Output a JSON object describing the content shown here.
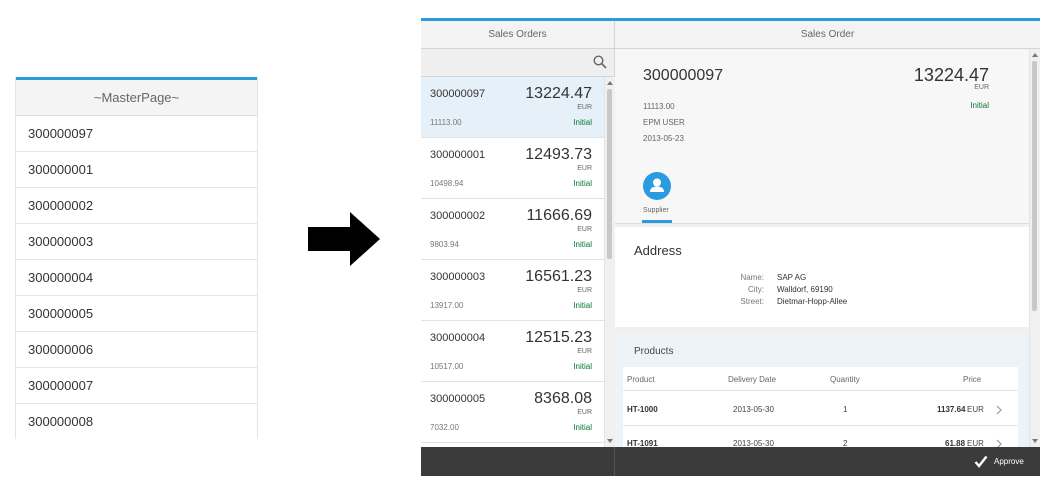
{
  "master_page": {
    "title": "~MasterPage~",
    "items": [
      "300000097",
      "300000001",
      "300000002",
      "300000003",
      "300000004",
      "300000005",
      "300000006",
      "300000007",
      "300000008"
    ]
  },
  "arrow": {
    "icon": "right-arrow-icon"
  },
  "split_app": {
    "master_header": "Sales Orders",
    "detail_header": "Sales Order",
    "search": {
      "placeholder": "",
      "icon": "search-icon"
    },
    "orders": [
      {
        "id": "300000097",
        "amount": "13224.47",
        "currency": "EUR",
        "sub": "11113.00",
        "status": "Initial",
        "selected": true
      },
      {
        "id": "300000001",
        "amount": "12493.73",
        "currency": "EUR",
        "sub": "10498.94",
        "status": "Initial"
      },
      {
        "id": "300000002",
        "amount": "11666.69",
        "currency": "EUR",
        "sub": "9803.94",
        "status": "Initial"
      },
      {
        "id": "300000003",
        "amount": "16561.23",
        "currency": "EUR",
        "sub": "13917.00",
        "status": "Initial"
      },
      {
        "id": "300000004",
        "amount": "12515.23",
        "currency": "EUR",
        "sub": "10517.00",
        "status": "Initial"
      },
      {
        "id": "300000005",
        "amount": "8368.08",
        "currency": "EUR",
        "sub": "7032.00",
        "status": "Initial"
      }
    ],
    "detail": {
      "title": "300000097",
      "number": "13224.47",
      "currency": "EUR",
      "status": "Initial",
      "attributes": [
        "11113.00",
        "EPM USER",
        "2013-05-23"
      ],
      "tab": {
        "label": "Supplier",
        "icon": "supplier-icon"
      },
      "address": {
        "heading": "Address",
        "fields": [
          {
            "label": "Name:",
            "value": "SAP AG"
          },
          {
            "label": "City:",
            "value": "Walldorf, 69190"
          },
          {
            "label": "Street:",
            "value": "Dietmar-Hopp-Allee"
          }
        ]
      },
      "products": {
        "heading": "Products",
        "columns": [
          "Product",
          "Delivery Date",
          "Quantity",
          "Price"
        ],
        "rows": [
          {
            "product": "HT-1000",
            "date": "2013-05-30",
            "qty": "1",
            "price": "1137.64",
            "currency": "EUR"
          },
          {
            "product": "HT-1091",
            "date": "2013-05-30",
            "qty": "2",
            "price": "61.88",
            "currency": "EUR"
          }
        ]
      }
    },
    "footer": {
      "approve_label": "Approve",
      "approve_icon": "checkmark-icon"
    },
    "colors": {
      "accent": "#2b9be0",
      "status_positive": "#007833",
      "footer": "#3b3b3b"
    }
  }
}
